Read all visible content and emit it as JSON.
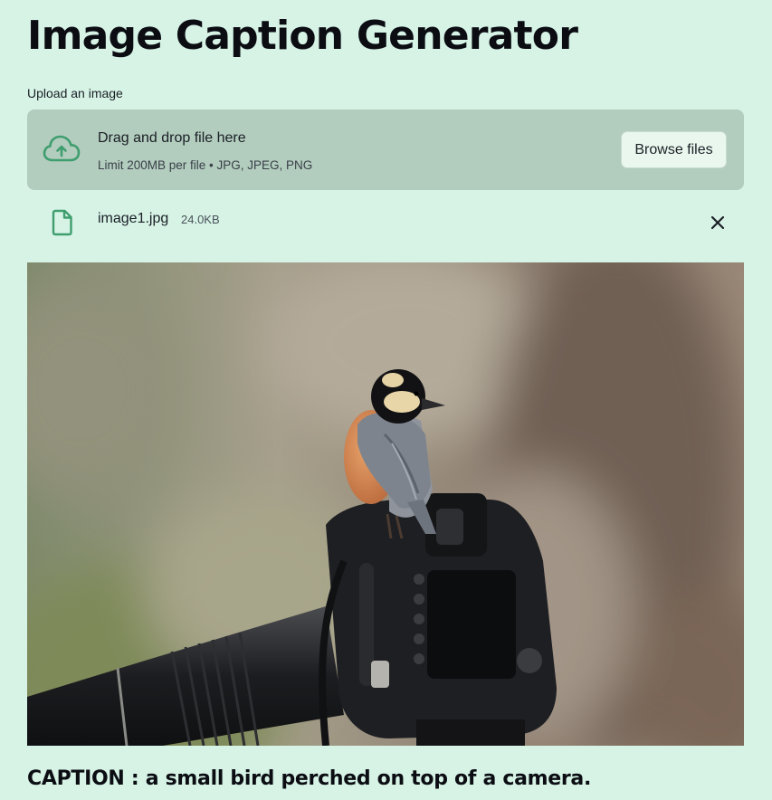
{
  "page": {
    "title": "Image Caption Generator"
  },
  "uploader": {
    "label": "Upload an image",
    "drop_text": "Drag and drop file here",
    "limit_text": "Limit 200MB per file • JPG, JPEG, PNG",
    "browse_label": "Browse files",
    "icon": "cloud-upload-icon"
  },
  "uploaded_file": {
    "name": "image1.jpg",
    "size": "24.0KB",
    "icon": "file-icon",
    "remove_icon": "close-icon"
  },
  "result": {
    "caption": "CAPTION : a small bird perched on top of a camera."
  },
  "colors": {
    "background": "#d6f3e6",
    "dropzone": "#b2ccbe",
    "accent": "#3f9e6e"
  }
}
